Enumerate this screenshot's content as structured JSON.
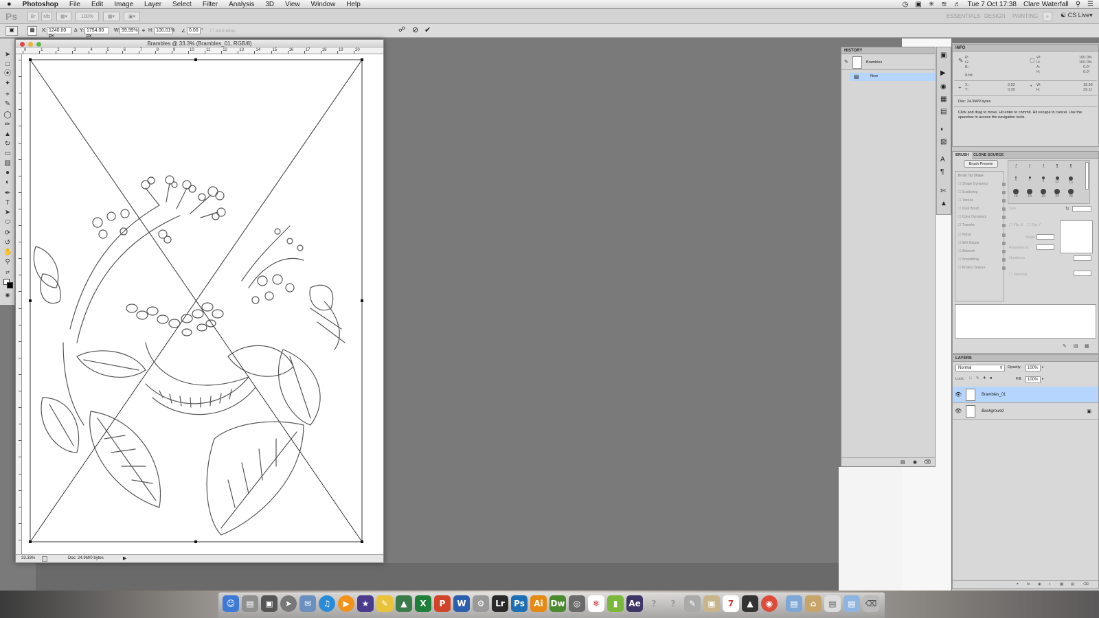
{
  "menubar": {
    "apple": "",
    "app": "Photoshop",
    "items": [
      "File",
      "Edit",
      "Image",
      "Layer",
      "Select",
      "Filter",
      "Analysis",
      "3D",
      "View",
      "Window",
      "Help"
    ],
    "clock": "Tue 7 Oct  17:38",
    "user": "Clare Waterfall"
  },
  "appbar": {
    "ps": "Ps",
    "zoom": "100%",
    "workspaces": [
      "ESSENTIALS",
      "DESIGN",
      "PAINTING"
    ],
    "cslive": "CS Live"
  },
  "options": {
    "x_label": "X:",
    "x": "1240.00 px",
    "y_label": "Y:",
    "y": "1754.00 px",
    "w_label": "W:",
    "w": "99.99%",
    "h_label": "H:",
    "h": "100.01%",
    "angle": "0.00",
    "antialias": "Anti-alias"
  },
  "document": {
    "title": "Brambles @ 33.3% (Brambles_01, RGB/8)",
    "zoom": "33.33%",
    "doc_size": "Doc: 24.9M/0 bytes",
    "ruler_ticks": [
      "0",
      "1",
      "2",
      "3",
      "4",
      "5",
      "6",
      "7",
      "8",
      "9",
      "10",
      "11",
      "12",
      "13",
      "14",
      "15",
      "16",
      "17",
      "18",
      "19",
      "20"
    ]
  },
  "history": {
    "header": "HISTORY",
    "snapshot": "Brambles",
    "state": "New"
  },
  "info": {
    "header": "INFO",
    "r": "R:",
    "g": "G:",
    "b": "B:",
    "bitdepth": "8-bit",
    "w_label": "W:",
    "w": "100.0%",
    "h_label": "H:",
    "h": "100.0%",
    "a_label": "A:",
    "a": "0.0°",
    "h2_label": "H:",
    "h2": "0.0°",
    "x_label": "X:",
    "x": "0.52",
    "y_label": "Y:",
    "y": "0.30",
    "w2_label": "W:",
    "w2": "19.96",
    "h3_label": "H:",
    "h3": "29.11",
    "doc": "Doc: 24.9M/0 bytes",
    "hint": "Click and drag to move. Hit enter to commit. Hit escape to cancel. Use the spacebar to access the navigation tools."
  },
  "brush": {
    "tab1": "BRUSH",
    "tab2": "CLONE SOURCE",
    "presets_button": "Brush Presets",
    "options": [
      "Brush Tip Shape",
      "Shape Dynamics",
      "Scattering",
      "Texture",
      "Dual Brush",
      "Color Dynamics",
      "Transfer",
      "Noise",
      "Wet Edges",
      "Airbrush",
      "Smoothing",
      "Protect Texture"
    ],
    "tip_sizes": [
      "1",
      "2",
      "3",
      "4",
      "5",
      "6",
      "7",
      "9",
      "12",
      "13",
      "16",
      "18",
      "19",
      "24",
      "28"
    ],
    "size": "Size",
    "flipx": "Flip X",
    "flipy": "Flip Y",
    "angle": "Angle:",
    "roundness": "Roundness:",
    "hardness": "Hardness",
    "spacing": "Spacing"
  },
  "layers": {
    "header": "LAYERS",
    "blend": "Normal",
    "opacity_label": "Opacity:",
    "opacity": "100%",
    "lock_label": "Lock:",
    "fill_label": "Fill:",
    "fill": "100%",
    "items": [
      "Brambles_01",
      "Background"
    ]
  },
  "dock": {
    "icons": [
      "Finder",
      "Preview",
      "Photo Booth",
      "Launchpad",
      "Mail",
      "iTunes",
      "VLC",
      "iMovie",
      "Stickies",
      "Preview2",
      "Excel",
      "PowerPoint",
      "Word",
      "Automator",
      "Lr",
      "Ps",
      "Ai",
      "Dw",
      "Photo",
      "Acrobat",
      "Evernote",
      "Ae",
      "Help",
      "Help2",
      "Script",
      "Photos",
      "iCal",
      "Dashboard",
      "Chrome",
      "Apps",
      "Home",
      "Docs",
      "Folder",
      "Trash"
    ],
    "labels": {
      "lr": "Lr",
      "ps": "Ps",
      "ai": "Ai",
      "dw": "Dw",
      "ae": "Ae",
      "x": "X",
      "p": "P",
      "w": "W",
      "cal": "7"
    }
  },
  "colors": {
    "selection": "#b5d5ff",
    "ps_blue": "#1d6fb5",
    "ai_orange": "#e58a14",
    "dw_green": "#4b8a2f"
  }
}
